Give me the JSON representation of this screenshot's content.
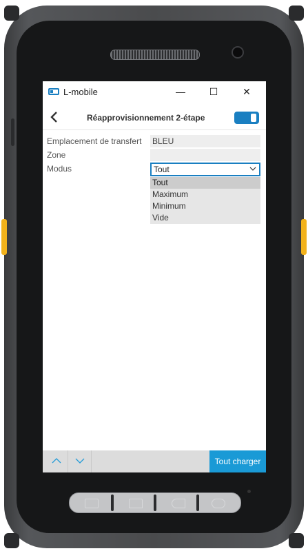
{
  "window": {
    "app_title": "L-mobile",
    "minimize_glyph": "—",
    "maximize_glyph": "☐",
    "close_glyph": "✕"
  },
  "header": {
    "back_glyph": "‹",
    "title": "Réapprovisionnement 2-étape"
  },
  "form": {
    "fields": [
      {
        "label": "Emplacement de transfert",
        "value": "BLEU"
      },
      {
        "label": "Zone",
        "value": ""
      }
    ],
    "modus": {
      "label": "Modus",
      "selected": "Tout",
      "options": [
        "Tout",
        "Maximum",
        "Minimum",
        "Vide"
      ]
    }
  },
  "footer": {
    "load_label": "Tout charger"
  },
  "colors": {
    "accent": "#1a7fc1",
    "button": "#1a9ad6",
    "device_body": "#4a4b4d",
    "side_buttons": "#f2b21b"
  },
  "icons": [
    "app-window-icon",
    "back-chevron-icon",
    "toggle-icon",
    "chevron-down-icon",
    "arrow-up-icon",
    "arrow-down-icon"
  ]
}
